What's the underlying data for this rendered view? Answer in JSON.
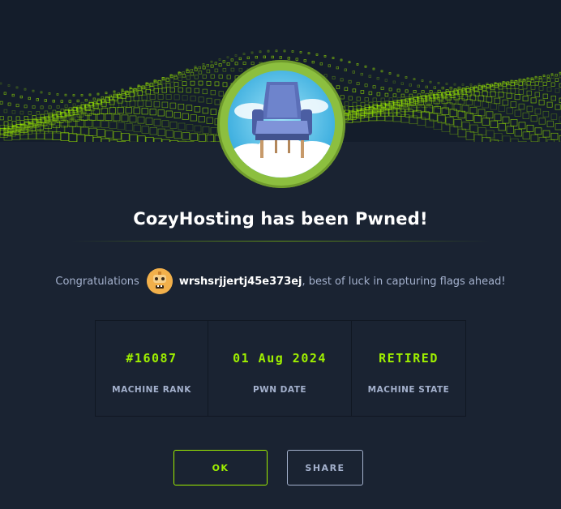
{
  "modal": {
    "title": "CozyHosting has been Pwned!",
    "congrats_prefix": "Congratulations",
    "username": "wrshsrjjertj45e373ej",
    "congrats_suffix": ", best of luck in capturing flags ahead!"
  },
  "stats": [
    {
      "value": "#16087",
      "label": "MACHINE RANK"
    },
    {
      "value": "01 Aug 2024",
      "label": "PWN DATE"
    },
    {
      "value": "RETIRED",
      "label": "MACHINE STATE"
    }
  ],
  "buttons": {
    "ok_label": "OK",
    "share_label": "SHARE"
  },
  "colors": {
    "background": "#1a2332",
    "accent": "#9fef00",
    "muted_text": "#a4b1cd",
    "ring": "#8cbf3f"
  },
  "icons": {
    "machine_avatar": "chair-on-cloud-icon",
    "user_avatar": "user-avatar-icon"
  }
}
